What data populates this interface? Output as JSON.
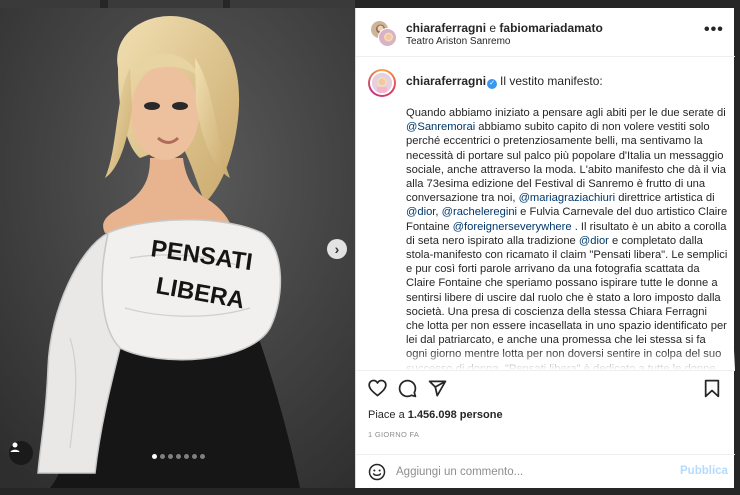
{
  "post": {
    "header": {
      "user_primary": "chiaraferragni",
      "connector": "e",
      "user_secondary": "fabiomariadamato",
      "location": "Teatro Ariston Sanremo",
      "more_label": "•••"
    },
    "caption": {
      "username": "chiaraferragni",
      "verified_mark": "✓",
      "title": "Il vestito manifesto:",
      "segments": [
        {
          "t": "Quando abbiamo iniziato a pensare agli abiti per le due serate di "
        },
        {
          "t": "@Sanremorai",
          "link": true
        },
        {
          "t": " abbiamo subito capito di non volere vestiti solo perché eccentrici o pretenziosamente belli, ma sentivamo la necessità di portare sul palco più popolare d'Italia un messaggio sociale, anche attraverso la moda. L'abito manifesto che dà il via alla 73esima edizione del Festival di Sanremo è frutto di una conversazione tra noi, "
        },
        {
          "t": "@mariagraziachiuri",
          "link": true
        },
        {
          "t": " direttrice artistica di "
        },
        {
          "t": "@dior",
          "link": true
        },
        {
          "t": ", "
        },
        {
          "t": "@racheleregini",
          "link": true
        },
        {
          "t": " e Fulvia Carnevale del duo artistico Claire Fontaine "
        },
        {
          "t": "@foreignerseverywhere",
          "link": true
        },
        {
          "t": " . Il risultato è un abito a corolla di seta nero ispirato alla tradizione "
        },
        {
          "t": "@dior",
          "link": true
        },
        {
          "t": " e completato dalla stola-manifesto con ricamato il claim \"Pensati libera\". Le semplici e pur così forti parole arrivano da una fotografia scattata da Claire Fontaine che speriamo possano ispirare tutte le donne a sentirsi libere di uscire dal ruolo che è stato a loro imposto dalla società. Una presa di coscienza della stessa Chiara Ferragni che lotta per non essere incasellata in uno spazio identificato per lei dal patriarcato, e anche una promessa che lei stessa si fa ogni giorno mentre lotta per non doversi sentire in colpa del suo successo di donna. \"Pensati libera\" è dedicato a tutte le donne che hanno voglia di sentirsi semplicemente loro stesse senza"
        }
      ]
    },
    "likes_prefix": "Piace a",
    "likes_count": "1.456.098",
    "likes_suffix": "persone",
    "timestamp": "1 GIORNO FA",
    "comment": {
      "placeholder": "Aggiungi un commento...",
      "publish_label": "Pubblica"
    },
    "media": {
      "stole_text_line1": "PENSATI",
      "stole_text_line2": "LIBERA",
      "next_label": "›",
      "carousel_total": 7,
      "carousel_active": 1
    },
    "colors": {
      "link": "#00376b",
      "verified": "#3897f0",
      "publish_disabled": "#b3dbff"
    }
  }
}
